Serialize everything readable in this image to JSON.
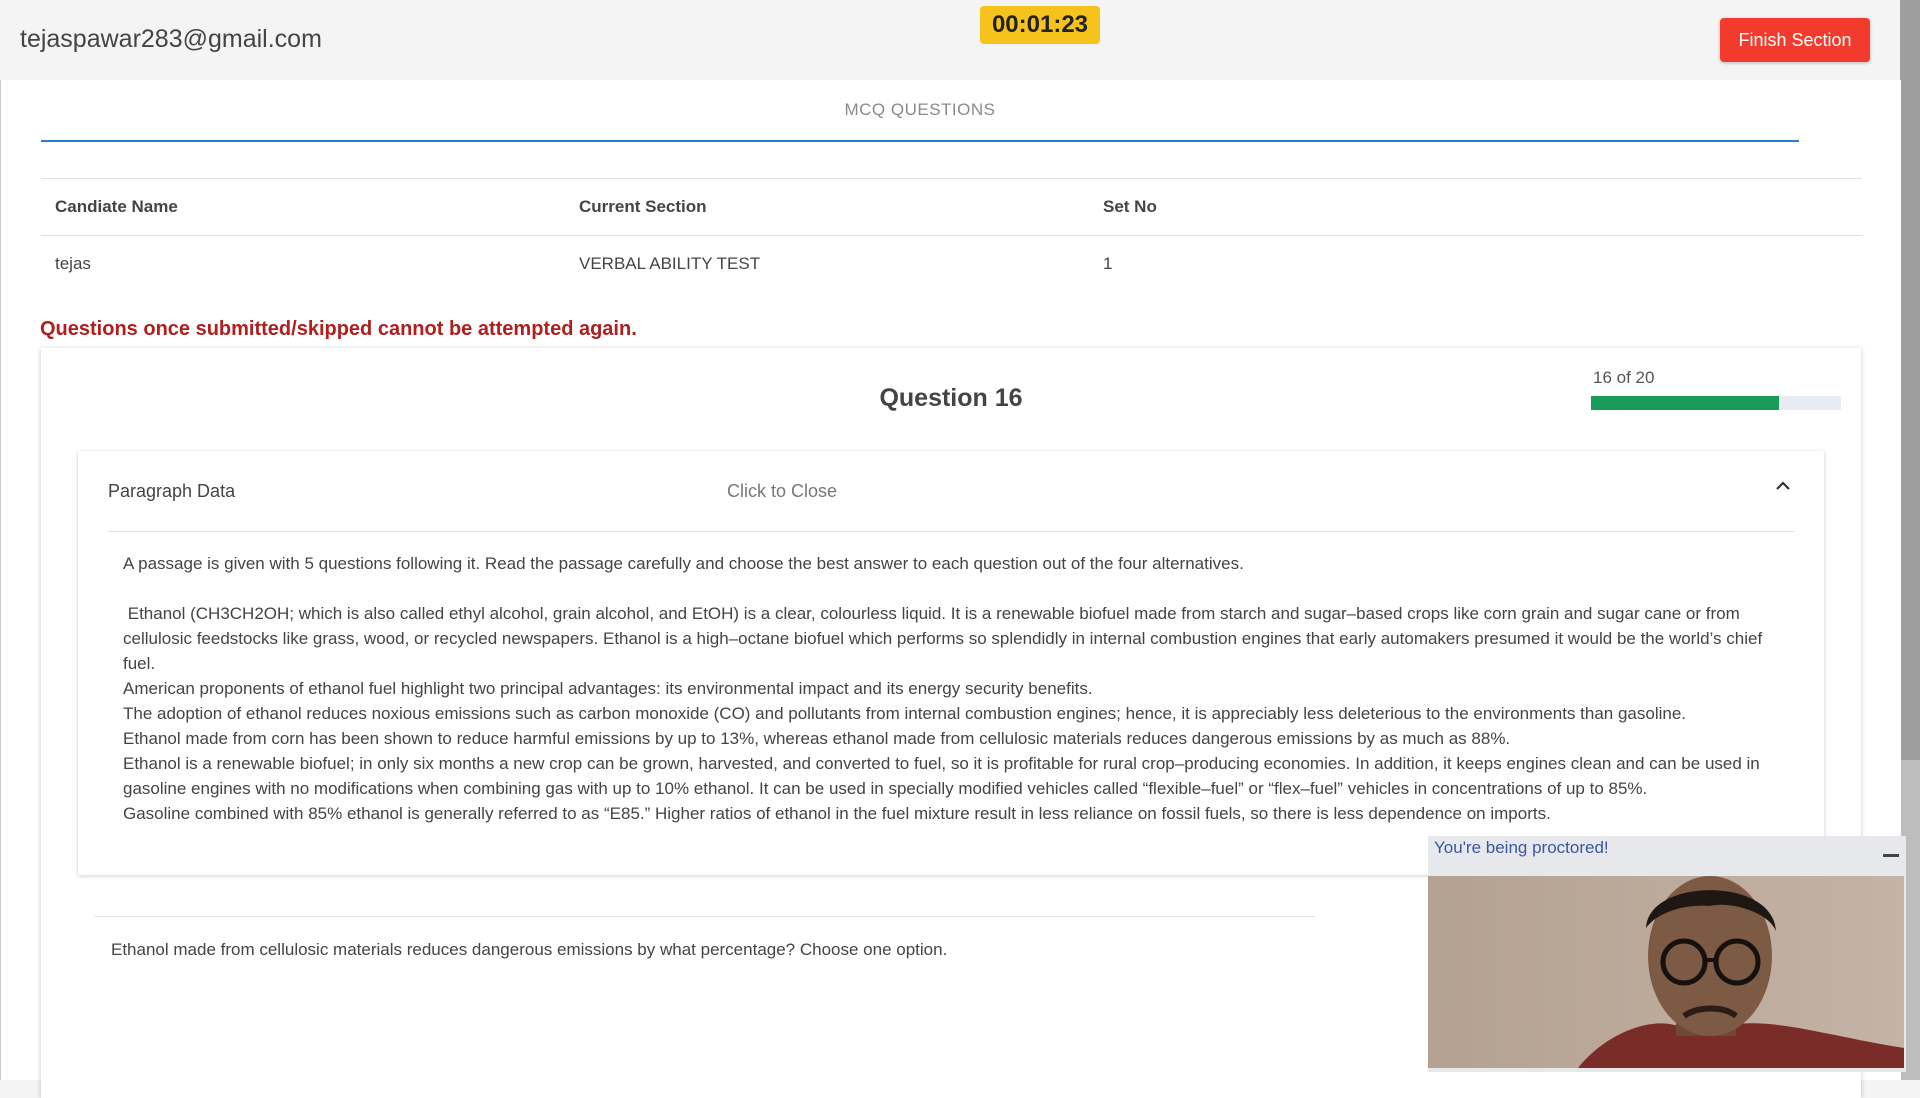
{
  "header": {
    "user_email": "tejaspawar283@gmail.com",
    "timer": "00:01:23",
    "finish_label": "Finish Section"
  },
  "tabs": {
    "mcq_label": "MCQ QUESTIONS"
  },
  "info_table": {
    "headers": [
      "Candiate Name",
      "Current Section",
      "Set No"
    ],
    "values": [
      "tejas",
      "VERBAL ABILITY TEST",
      "1"
    ]
  },
  "warning": "Questions once submitted/skipped cannot be attempted again.",
  "question": {
    "title": "Question 16",
    "progress_label": "16 of 20",
    "progress_fraction": 0.75,
    "text": "Ethanol made from cellulosic materials reduces dangerous emissions by what percentage? Choose one option."
  },
  "paragraph_panel": {
    "title": "Paragraph Data",
    "toggle_label": "Click to Close",
    "intro": "A passage is given with 5 questions following it. Read the passage carefully and choose the best answer to each question out of the four alternatives.",
    "lines": [
      " Ethanol (CH3CH2OH; which is also called ethyl alcohol, grain alcohol, and EtOH) is a clear, colourless liquid. It is a renewable biofuel made from starch and sugar–based crops like corn grain and sugar cane or from cellulosic feedstocks like grass, wood, or recycled newspapers. Ethanol is a high–octane biofuel which performs so splendidly in internal combustion engines that early automakers presumed it would be the world’s chief fuel.",
      "American proponents of ethanol fuel highlight two principal advantages: its environmental impact and its energy security benefits.",
      "The adoption of ethanol reduces noxious emissions such as carbon monoxide (CO) and pollutants from internal combustion engines; hence, it is appreciably less deleterious to the environments than gasoline.",
      "Ethanol made from corn has been shown to reduce harmful emissions by up to 13%, whereas ethanol made from cellulosic materials reduces dangerous emissions by as much as 88%.",
      "Ethanol is a renewable biofuel; in only six months a new crop can be grown, harvested, and converted to fuel, so it is profitable for rural crop–producing economies. In addition, it keeps engines clean and can be used in gasoline engines with no modifications when combining gas with up to 10% ethanol. It can be used in specially modified vehicles called “flexible–fuel” or “flex–fuel” vehicles in concentrations of up to 85%.",
      "Gasoline combined with 85% ethanol is generally referred to as “E85.” Higher ratios of ethanol in the fuel mixture result in less reliance on fossil fuels, so there is less dependence on imports."
    ]
  },
  "proctor": {
    "title": "You're being proctored!"
  },
  "icons": {
    "collapse": "chevron-up-icon",
    "minimize": "minimize-icon"
  },
  "colors": {
    "timer_bg": "#f6c21c",
    "finish_bg": "#f23b2d",
    "progress_fill": "#189b58",
    "warning_text": "#b01e1e",
    "tab_underline": "#2a7bd3"
  }
}
